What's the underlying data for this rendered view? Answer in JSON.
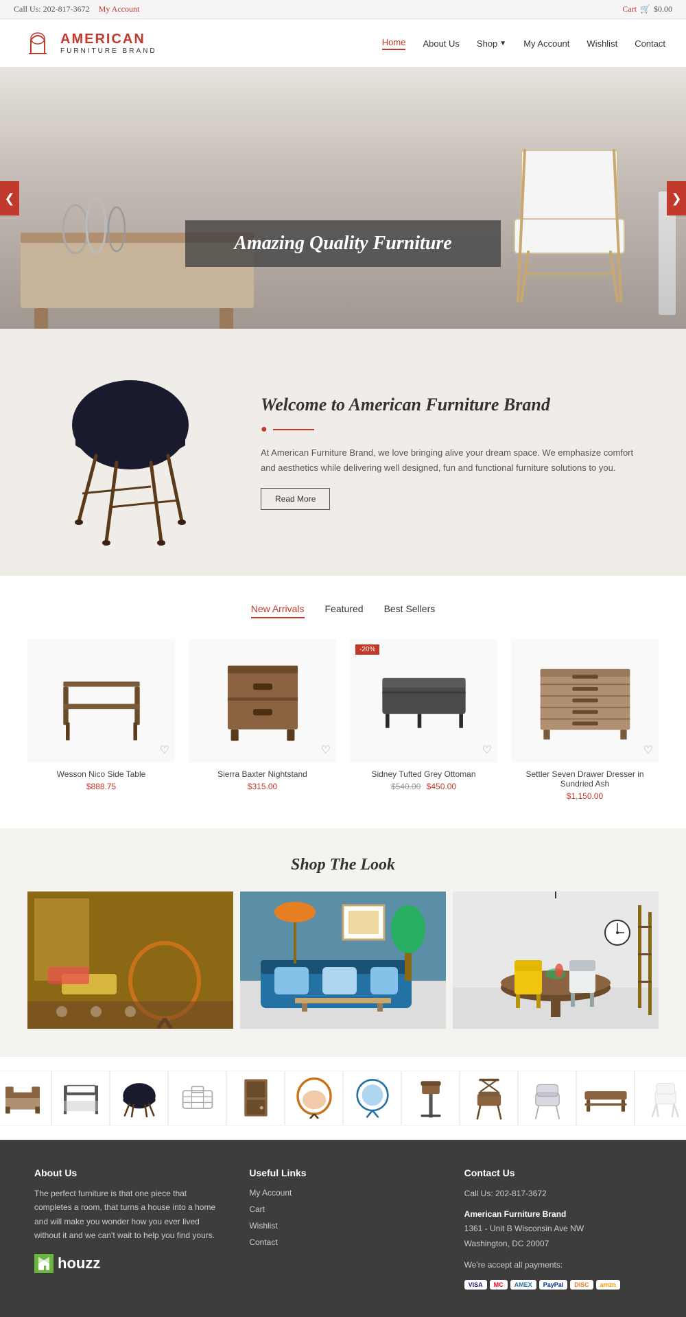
{
  "topbar": {
    "call_label": "Call Us: 202-817-3672",
    "account_link": "My Account",
    "cart_link": "Cart",
    "cart_price": "$0.00"
  },
  "nav": {
    "logo_brand": "AMERICAN",
    "logo_sub": "FURNITURE BRAND",
    "links": [
      {
        "label": "Home",
        "active": true
      },
      {
        "label": "About Us",
        "active": false
      },
      {
        "label": "Shop",
        "active": false,
        "has_dropdown": true
      },
      {
        "label": "My Account",
        "active": false
      },
      {
        "label": "Wishlist",
        "active": false
      },
      {
        "label": "Contact",
        "active": false
      }
    ]
  },
  "hero": {
    "slide_text": "Amazing Quality Furniture",
    "prev_label": "❮",
    "next_label": "❯"
  },
  "welcome": {
    "heading": "Welcome to American Furniture Brand",
    "body": "At American Furniture Brand, we love bringing alive your dream space. We emphasize comfort and aesthetics while delivering well designed, fun and functional furniture solutions to you.",
    "read_more": "Read More"
  },
  "products": {
    "tabs": [
      {
        "label": "New Arrivals",
        "active": true
      },
      {
        "label": "Featured",
        "active": false
      },
      {
        "label": "Best Sellers",
        "active": false
      }
    ],
    "items": [
      {
        "name": "Wesson Nico Side Table",
        "price": "$888.75",
        "old_price": null,
        "badge": null
      },
      {
        "name": "Sierra Baxter Nightstand",
        "price": "$315.00",
        "old_price": null,
        "badge": null
      },
      {
        "name": "Sidney Tufted Grey Ottoman",
        "price": "$450.00",
        "old_price": "$540.00",
        "badge": "-20%"
      },
      {
        "name": "Settler Seven Drawer Dresser in Sundried Ash",
        "price": "$1,150.00",
        "old_price": null,
        "badge": null
      }
    ]
  },
  "shop_look": {
    "heading": "Shop The Look",
    "images": [
      {
        "alt": "Bohemian living room"
      },
      {
        "alt": "Modern blue sofa room"
      },
      {
        "alt": "Dining room with yellow chair"
      }
    ]
  },
  "footer": {
    "about": {
      "heading": "About Us",
      "body": "The perfect furniture is that one piece that completes a room, that turns a house into a home and will make you wonder how you ever lived without it and we can't wait to help you find yours.",
      "houzz_label": "houzz"
    },
    "links": {
      "heading": "Useful Links",
      "items": [
        "My Account",
        "Cart",
        "Wishlist",
        "Contact"
      ]
    },
    "contact": {
      "heading": "Contact Us",
      "phone": "Call Us: 202-817-3672",
      "brand": "American Furniture Brand",
      "address": "1361 - Unit B Wisconsin Ave NW",
      "city": "Washington, DC 20007",
      "payments_label": "We're accept all payments:"
    }
  }
}
